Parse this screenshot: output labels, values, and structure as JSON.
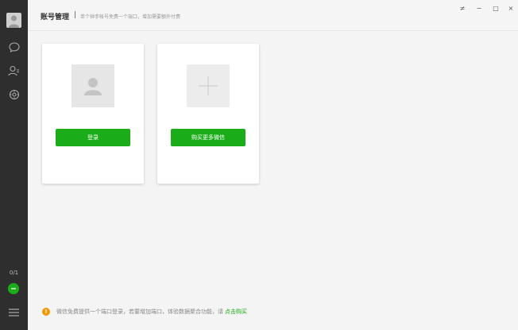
{
  "sidebar": {
    "counter": "0/1",
    "icons": [
      "avatar-icon",
      "chat-icon",
      "contacts-icon",
      "settings-icon",
      "online-status-icon",
      "menu-icon"
    ]
  },
  "header": {
    "title": "账号管理",
    "separator": "|",
    "subtitle": "单个钟手帐号免费一个端口，增加需要额外付费"
  },
  "window_controls": {
    "pin": "≠",
    "minimize": "−",
    "maximize": "□",
    "close": "×"
  },
  "cards": [
    {
      "button_label": "登录",
      "icon": "user-placeholder-icon"
    },
    {
      "button_label": "购买更多微信",
      "icon": "plus-icon"
    }
  ],
  "footer": {
    "message": "微信免费提供一个端口登录，若要增加端口，体验数据聚合功能，请",
    "link": "点击购买"
  },
  "colors": {
    "accent": "#1aad19",
    "sidebar": "#2e2e2e",
    "warning": "#f39800"
  }
}
